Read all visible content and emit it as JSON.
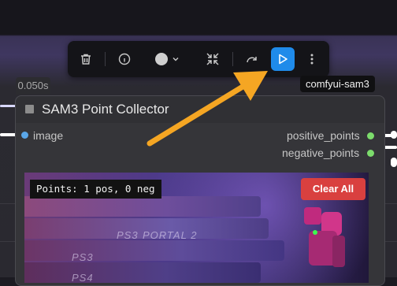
{
  "toolbar": {
    "buttons": [
      {
        "name": "delete",
        "icon": "trash-icon"
      },
      {
        "name": "info",
        "icon": "info-icon"
      },
      {
        "name": "color",
        "icon": "color-circle-icon",
        "dropdown": "chevron-down-icon"
      },
      {
        "name": "collapse",
        "icon": "collapse-arrows-icon"
      },
      {
        "name": "bypass",
        "icon": "redo-arrow-icon"
      },
      {
        "name": "run",
        "icon": "play-icon",
        "color": "#1f8bea"
      },
      {
        "name": "more",
        "icon": "more-vertical-icon"
      }
    ]
  },
  "tooltip": {
    "text": "comfyui-sam3"
  },
  "node": {
    "time": "0.050s",
    "title": "SAM3 Point Collector",
    "input": {
      "label": "image",
      "color": "#5aa6e8"
    },
    "outputs": [
      {
        "label": "positive_points",
        "color": "#7cdc6c"
      },
      {
        "label": "negative_points",
        "color": "#7cdc6c"
      }
    ]
  },
  "preview": {
    "points_label": "Points: 1 pos, 0 neg",
    "clear_button": "Clear All",
    "disc_labels": [
      "PS3",
      "PORTAL 2",
      "PS3",
      "PS4"
    ]
  },
  "annotation": {
    "arrow_color": "#f5a623"
  }
}
